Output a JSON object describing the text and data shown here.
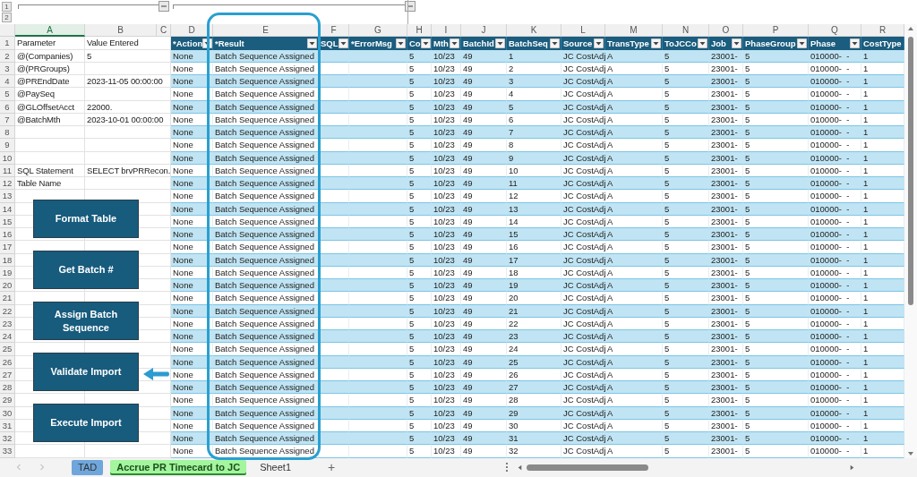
{
  "outline": {
    "levels": [
      "1",
      "2"
    ]
  },
  "column_letters": [
    {
      "label": "A",
      "selected": true
    },
    {
      "label": "B",
      "selected": false
    },
    {
      "label": "C",
      "selected": false
    },
    {
      "label": "D",
      "selected": false
    },
    {
      "label": "E",
      "selected": false
    },
    {
      "label": "F",
      "selected": false
    },
    {
      "label": "G",
      "selected": false
    },
    {
      "label": "H",
      "selected": false
    },
    {
      "label": "I",
      "selected": false
    },
    {
      "label": "J",
      "selected": false
    },
    {
      "label": "K",
      "selected": false
    },
    {
      "label": "L",
      "selected": false
    },
    {
      "label": "M",
      "selected": false
    },
    {
      "label": "N",
      "selected": false
    },
    {
      "label": "O",
      "selected": false
    },
    {
      "label": "P",
      "selected": false
    },
    {
      "label": "Q",
      "selected": false
    },
    {
      "label": "R",
      "selected": false
    }
  ],
  "row_numbers": [
    "1",
    "2",
    "3",
    "4",
    "5",
    "6",
    "7",
    "8",
    "9",
    "10",
    "11",
    "12",
    "13",
    "14",
    "15",
    "16",
    "17",
    "18",
    "19",
    "20",
    "21",
    "22",
    "23",
    "24",
    "25",
    "26",
    "27",
    "28",
    "29",
    "30",
    "31",
    "32",
    "33"
  ],
  "parameters_header": {
    "name": "Parameter",
    "value": "Value Entered"
  },
  "parameters": [
    {
      "kind": "entry",
      "name": "@(Companies)",
      "value": "5"
    },
    {
      "kind": "entry",
      "name": "@(PRGroups)"
    },
    {
      "kind": "entry",
      "name": "@PREndDate",
      "value": "2023-11-05 00:00:00"
    },
    {
      "kind": "entry",
      "name": "@PaySeq"
    },
    {
      "kind": "entry",
      "name": "@GLOffsetAcct",
      "value": "22000."
    },
    {
      "kind": "entry",
      "name": "@BatchMth",
      "value": "2023-10-01 00:00:00"
    },
    {
      "kind": "blank"
    },
    {
      "kind": "blank"
    },
    {
      "kind": "blank"
    },
    {
      "kind": "entry",
      "name": "SQL Statement",
      "value": "SELECT brvPRRecon."
    },
    {
      "kind": "entry",
      "name": "Table Name"
    }
  ],
  "table": {
    "columns": [
      {
        "label": "*Action",
        "filter": true
      },
      {
        "label": "*Result",
        "filter": true
      },
      {
        "label": "SQL",
        "filter": true
      },
      {
        "label": "*ErrorMsg",
        "filter": true
      },
      {
        "label": "Co",
        "filter": true
      },
      {
        "label": "Mth",
        "filter": true
      },
      {
        "label": "BatchId",
        "filter": true
      },
      {
        "label": "BatchSeq",
        "filter": true
      },
      {
        "label": "Source",
        "filter": true
      },
      {
        "label": "TransType",
        "filter": true
      },
      {
        "label": "ToJCCo",
        "filter": true
      },
      {
        "label": "Job",
        "filter": true
      },
      {
        "label": "PhaseGroup",
        "filter": true
      },
      {
        "label": "Phase",
        "filter": true
      },
      {
        "label": "CostType",
        "filter": false
      }
    ],
    "rows": [
      [
        "None",
        "Batch Sequence Assigned",
        null,
        null,
        "5",
        "10/23",
        "49",
        "1",
        "JC CostAdj",
        "A",
        "5",
        "23001-",
        "5",
        "010000-  -",
        "1"
      ],
      [
        "None",
        "Batch Sequence Assigned",
        null,
        null,
        "5",
        "10/23",
        "49",
        "2",
        "JC CostAdj",
        "A",
        "5",
        "23001-",
        "5",
        "010000-  -",
        "1"
      ],
      [
        "None",
        "Batch Sequence Assigned",
        null,
        null,
        "5",
        "10/23",
        "49",
        "3",
        "JC CostAdj",
        "A",
        "5",
        "23001-",
        "5",
        "010000-  -",
        "1"
      ],
      [
        "None",
        "Batch Sequence Assigned",
        null,
        null,
        "5",
        "10/23",
        "49",
        "4",
        "JC CostAdj",
        "A",
        "5",
        "23001-",
        "5",
        "010000-  -",
        "1"
      ],
      [
        "None",
        "Batch Sequence Assigned",
        null,
        null,
        "5",
        "10/23",
        "49",
        "5",
        "JC CostAdj",
        "A",
        "5",
        "23001-",
        "5",
        "010000-  -",
        "1"
      ],
      [
        "None",
        "Batch Sequence Assigned",
        null,
        null,
        "5",
        "10/23",
        "49",
        "6",
        "JC CostAdj",
        "A",
        "5",
        "23001-",
        "5",
        "010000-  -",
        "1"
      ],
      [
        "None",
        "Batch Sequence Assigned",
        null,
        null,
        "5",
        "10/23",
        "49",
        "7",
        "JC CostAdj",
        "A",
        "5",
        "23001-",
        "5",
        "010000-  -",
        "1"
      ],
      [
        "None",
        "Batch Sequence Assigned",
        null,
        null,
        "5",
        "10/23",
        "49",
        "8",
        "JC CostAdj",
        "A",
        "5",
        "23001-",
        "5",
        "010000-  -",
        "1"
      ],
      [
        "None",
        "Batch Sequence Assigned",
        null,
        null,
        "5",
        "10/23",
        "49",
        "9",
        "JC CostAdj",
        "A",
        "5",
        "23001-",
        "5",
        "010000-  -",
        "1"
      ],
      [
        "None",
        "Batch Sequence Assigned",
        null,
        null,
        "5",
        "10/23",
        "49",
        "10",
        "JC CostAdj",
        "A",
        "5",
        "23001-",
        "5",
        "010000-  -",
        "1"
      ],
      [
        "None",
        "Batch Sequence Assigned",
        null,
        null,
        "5",
        "10/23",
        "49",
        "11",
        "JC CostAdj",
        "A",
        "5",
        "23001-",
        "5",
        "010000-  -",
        "1"
      ],
      [
        "None",
        "Batch Sequence Assigned",
        null,
        null,
        "5",
        "10/23",
        "49",
        "12",
        "JC CostAdj",
        "A",
        "5",
        "23001-",
        "5",
        "010000-  -",
        "1"
      ],
      [
        "None",
        "Batch Sequence Assigned",
        null,
        null,
        "5",
        "10/23",
        "49",
        "13",
        "JC CostAdj",
        "A",
        "5",
        "23001-",
        "5",
        "010000-  -",
        "1"
      ],
      [
        "None",
        "Batch Sequence Assigned",
        null,
        null,
        "5",
        "10/23",
        "49",
        "14",
        "JC CostAdj",
        "A",
        "5",
        "23001-",
        "5",
        "010000-  -",
        "1"
      ],
      [
        "None",
        "Batch Sequence Assigned",
        null,
        null,
        "5",
        "10/23",
        "49",
        "15",
        "JC CostAdj",
        "A",
        "5",
        "23001-",
        "5",
        "010000-  -",
        "1"
      ],
      [
        "None",
        "Batch Sequence Assigned",
        null,
        null,
        "5",
        "10/23",
        "49",
        "16",
        "JC CostAdj",
        "A",
        "5",
        "23001-",
        "5",
        "010000-  -",
        "1"
      ],
      [
        "None",
        "Batch Sequence Assigned",
        null,
        null,
        "5",
        "10/23",
        "49",
        "17",
        "JC CostAdj",
        "A",
        "5",
        "23001-",
        "5",
        "010000-  -",
        "1"
      ],
      [
        "None",
        "Batch Sequence Assigned",
        null,
        null,
        "5",
        "10/23",
        "49",
        "18",
        "JC CostAdj",
        "A",
        "5",
        "23001-",
        "5",
        "010000-  -",
        "1"
      ],
      [
        "None",
        "Batch Sequence Assigned",
        null,
        null,
        "5",
        "10/23",
        "49",
        "19",
        "JC CostAdj",
        "A",
        "5",
        "23001-",
        "5",
        "010000-  -",
        "1"
      ],
      [
        "None",
        "Batch Sequence Assigned",
        null,
        null,
        "5",
        "10/23",
        "49",
        "20",
        "JC CostAdj",
        "A",
        "5",
        "23001-",
        "5",
        "010000-  -",
        "1"
      ],
      [
        "None",
        "Batch Sequence Assigned",
        null,
        null,
        "5",
        "10/23",
        "49",
        "21",
        "JC CostAdj",
        "A",
        "5",
        "23001-",
        "5",
        "010000-  -",
        "1"
      ],
      [
        "None",
        "Batch Sequence Assigned",
        null,
        null,
        "5",
        "10/23",
        "49",
        "22",
        "JC CostAdj",
        "A",
        "5",
        "23001-",
        "5",
        "010000-  -",
        "1"
      ],
      [
        "None",
        "Batch Sequence Assigned",
        null,
        null,
        "5",
        "10/23",
        "49",
        "23",
        "JC CostAdj",
        "A",
        "5",
        "23001-",
        "5",
        "010000-  -",
        "1"
      ],
      [
        "None",
        "Batch Sequence Assigned",
        null,
        null,
        "5",
        "10/23",
        "49",
        "24",
        "JC CostAdj",
        "A",
        "5",
        "23001-",
        "5",
        "010000-  -",
        "1"
      ],
      [
        "None",
        "Batch Sequence Assigned",
        null,
        null,
        "5",
        "10/23",
        "49",
        "25",
        "JC CostAdj",
        "A",
        "5",
        "23001-",
        "5",
        "010000-  -",
        "1"
      ],
      [
        "None",
        "Batch Sequence Assigned",
        null,
        null,
        "5",
        "10/23",
        "49",
        "26",
        "JC CostAdj",
        "A",
        "5",
        "23001-",
        "5",
        "010000-  -",
        "1"
      ],
      [
        "None",
        "Batch Sequence Assigned",
        null,
        null,
        "5",
        "10/23",
        "49",
        "27",
        "JC CostAdj",
        "A",
        "5",
        "23001-",
        "5",
        "010000-  -",
        "1"
      ],
      [
        "None",
        "Batch Sequence Assigned",
        null,
        null,
        "5",
        "10/23",
        "49",
        "28",
        "JC CostAdj",
        "A",
        "5",
        "23001-",
        "5",
        "010000-  -",
        "1"
      ],
      [
        "None",
        "Batch Sequence Assigned",
        null,
        null,
        "5",
        "10/23",
        "49",
        "29",
        "JC CostAdj",
        "A",
        "5",
        "23001-",
        "5",
        "010000-  -",
        "1"
      ],
      [
        "None",
        "Batch Sequence Assigned",
        null,
        null,
        "5",
        "10/23",
        "49",
        "30",
        "JC CostAdj",
        "A",
        "5",
        "23001-",
        "5",
        "010000-  -",
        "1"
      ],
      [
        "None",
        "Batch Sequence Assigned",
        null,
        null,
        "5",
        "10/23",
        "49",
        "31",
        "JC CostAdj",
        "A",
        "5",
        "23001-",
        "5",
        "010000-  -",
        "1"
      ],
      [
        "None",
        "Batch Sequence Assigned",
        null,
        null,
        "5",
        "10/23",
        "49",
        "32",
        "JC CostAdj",
        "A",
        "5",
        "23001-",
        "5",
        "010000-  -",
        "1"
      ]
    ]
  },
  "macro_buttons": [
    "Format Table",
    "Get Batch #",
    "Assign Batch Sequence",
    "Validate Import",
    "Execute Import"
  ],
  "sheet_tabs": [
    {
      "label": "TAD",
      "selected": false,
      "color": "#6fa6dc"
    },
    {
      "label": "Accrue PR Timecard to JC",
      "selected": true,
      "color": "#a3f59e"
    },
    {
      "label": "Sheet1",
      "selected": false
    }
  ],
  "add_sheet": "+"
}
